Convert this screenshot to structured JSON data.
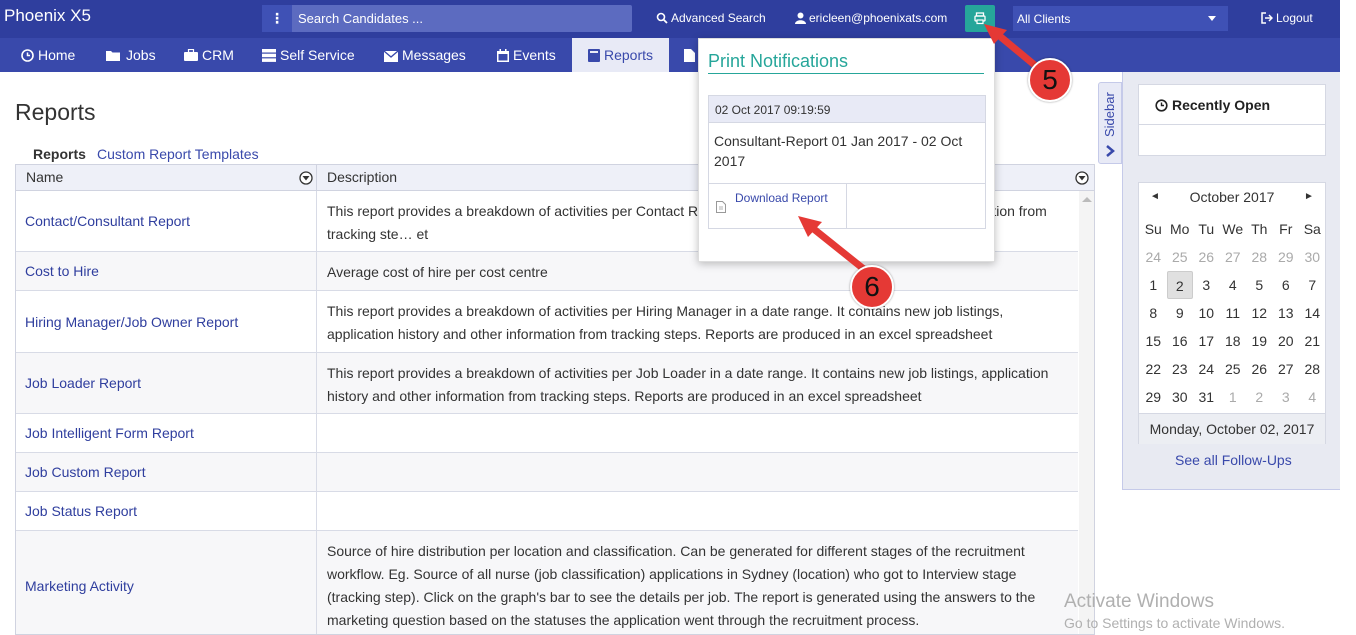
{
  "app": {
    "title": "Phoenix X5"
  },
  "header": {
    "search_placeholder": "Search Candidates ...",
    "advanced_search": "Advanced Search",
    "user_email": "ericleen@phoenixats.com",
    "client_select": "All Clients",
    "logout": "Logout"
  },
  "nav": {
    "items": [
      {
        "label": "Home",
        "icon": "clock-icon"
      },
      {
        "label": "Jobs",
        "icon": "folder-icon"
      },
      {
        "label": "CRM",
        "icon": "briefcase-icon"
      },
      {
        "label": "Self Service",
        "icon": "server-icon"
      },
      {
        "label": "Messages",
        "icon": "envelope-icon"
      },
      {
        "label": "Events",
        "icon": "calendar-icon"
      },
      {
        "label": "Reports",
        "icon": "book-icon",
        "active": true
      }
    ]
  },
  "page": {
    "title": "Reports",
    "subtabs": [
      "Reports",
      "Custom Report Templates"
    ]
  },
  "table": {
    "columns": [
      "Name",
      "Description"
    ],
    "rows": [
      {
        "name": "Contact/Consultant Report",
        "description": "This report provides a breakdown of activities per Contact R… listings, application history and other information from tracking ste… et"
      },
      {
        "name": "Cost to Hire",
        "description": "Average cost of hire per cost centre"
      },
      {
        "name": "Hiring Manager/Job Owner Report",
        "description": "This report provides a breakdown of activities per Hiring Manager in a date range. It contains new job listings, application history and other information from tracking steps. Reports are produced in an excel spreadsheet"
      },
      {
        "name": "Job Loader Report",
        "description": "This report provides a breakdown of activities per Job Loader in a date range. It contains new job listings, application history and other information from tracking steps. Reports are produced in an excel spreadsheet"
      },
      {
        "name": "Job Intelligent Form Report",
        "description": ""
      },
      {
        "name": "Job Custom Report",
        "description": ""
      },
      {
        "name": "Job Status Report",
        "description": ""
      },
      {
        "name": "Marketing Activity",
        "description": "Source of hire distribution per location and classification. Can be generated for different stages of the recruitment workflow. Eg. Source of all nurse (job classification) applications in Sydney (location) who got to Interview stage (tracking step). Click on the graph's bar to see the details per job. The report is generated using the answers to the marketing question based on the statuses the application went through the recruitment process."
      }
    ]
  },
  "print_popup": {
    "title": "Print Notifications",
    "date": "02 Oct 2017 09:19:59",
    "body": "Consultant-Report 01 Jan 2017 - 02 Oct 2017",
    "download": "Download Report"
  },
  "sidebar": {
    "tab_label": "Sidebar",
    "recently_open": "Recently Open",
    "calendar": {
      "month": "October 2017",
      "dow": [
        "Su",
        "Mo",
        "Tu",
        "We",
        "Th",
        "Fr",
        "Sa"
      ],
      "weeks": [
        [
          "24",
          "25",
          "26",
          "27",
          "28",
          "29",
          "30"
        ],
        [
          "1",
          "2",
          "3",
          "4",
          "5",
          "6",
          "7"
        ],
        [
          "8",
          "9",
          "10",
          "11",
          "12",
          "13",
          "14"
        ],
        [
          "15",
          "16",
          "17",
          "18",
          "19",
          "20",
          "21"
        ],
        [
          "22",
          "23",
          "24",
          "25",
          "26",
          "27",
          "28"
        ],
        [
          "29",
          "30",
          "31",
          "1",
          "2",
          "3",
          "4"
        ]
      ],
      "today": "Monday, October 02, 2017"
    },
    "followups": "See all Follow-Ups"
  },
  "callouts": [
    "5",
    "6"
  ],
  "watermark": {
    "line1": "Activate Windows",
    "line2": "Go to Settings to activate Windows."
  },
  "colors": {
    "topbar": "#2f3e9e",
    "navbar": "#3949ab",
    "accent": "#26a69a",
    "callout": "#e53935"
  }
}
